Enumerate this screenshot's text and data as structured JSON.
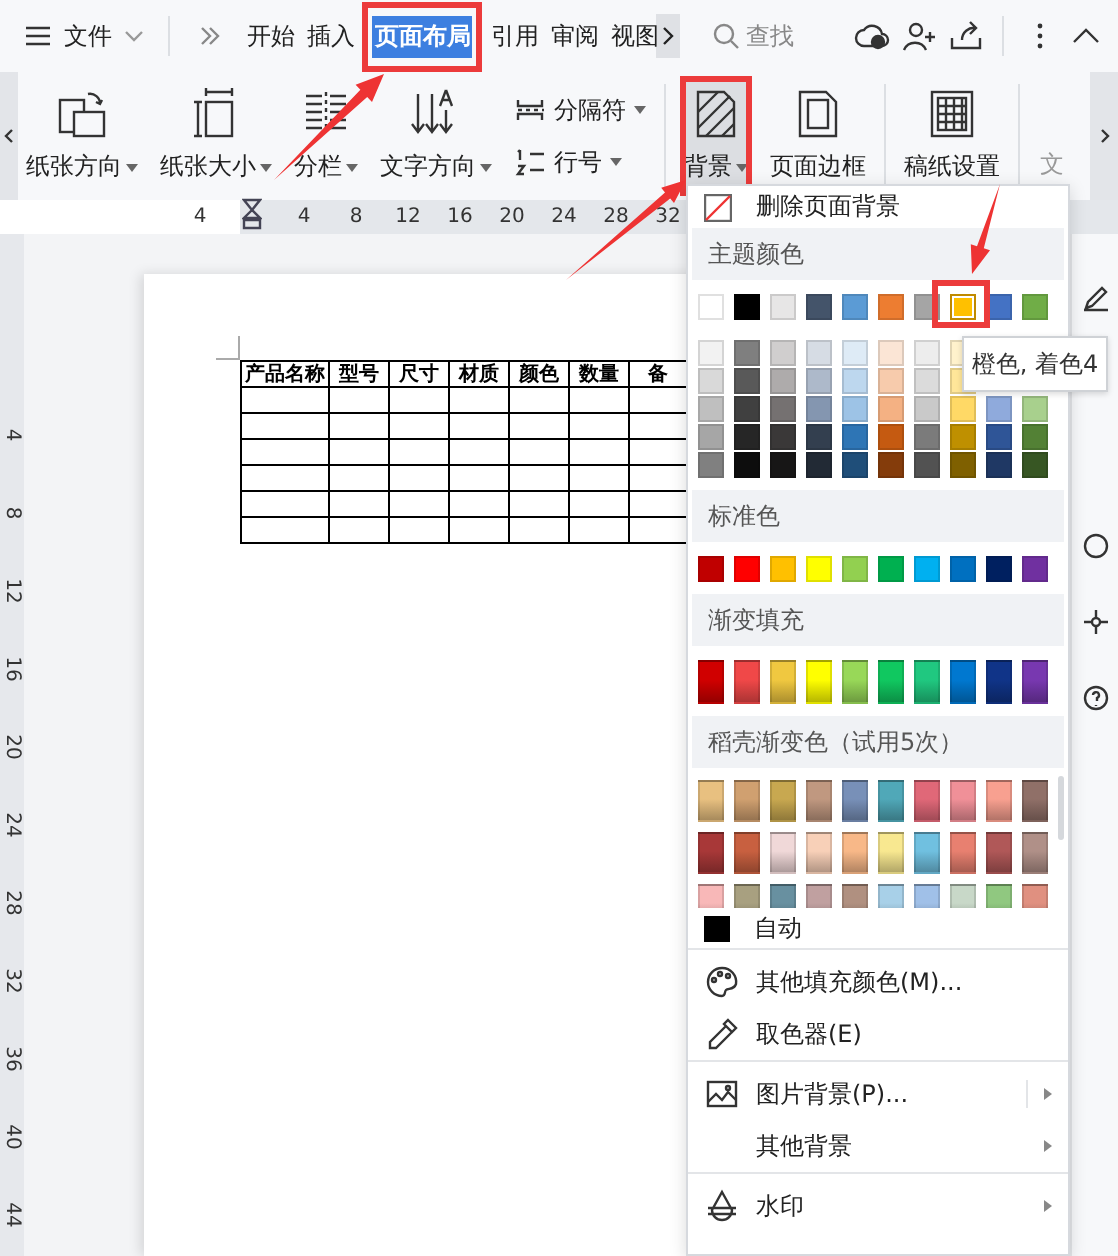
{
  "menu_button": {
    "label": "文件"
  },
  "tabs": [
    {
      "label": "开始",
      "selected": false
    },
    {
      "label": "插入",
      "selected": false
    },
    {
      "label": "页面布局",
      "selected": true
    },
    {
      "label": "引用",
      "selected": false
    },
    {
      "label": "审阅",
      "selected": false
    },
    {
      "label": "视图",
      "selected": false
    }
  ],
  "search": {
    "placeholder": "查找"
  },
  "ribbon": [
    {
      "kind": "orientation",
      "label": "纸张方向",
      "dropdown": true
    },
    {
      "kind": "size",
      "label": "纸张大小",
      "dropdown": true
    },
    {
      "kind": "columns",
      "label": "分栏",
      "dropdown": true
    },
    {
      "kind": "direction",
      "label": "文字方向",
      "dropdown": true
    },
    {
      "kind": "breaks",
      "label": "分隔符",
      "dropdown": true
    },
    {
      "kind": "line_numbers",
      "label": "行号",
      "dropdown": true
    },
    {
      "kind": "background",
      "label": "背景",
      "dropdown": true,
      "open": true,
      "separator_before": true
    },
    {
      "kind": "border",
      "label": "页面边框",
      "dropdown": false
    },
    {
      "kind": "grid",
      "label": "稿纸设置",
      "dropdown": false,
      "separator_before": true
    },
    {
      "kind": "partial",
      "label": "文",
      "dropdown": false,
      "separator_before": true
    }
  ],
  "ruler": {
    "top_marks": [
      "4",
      "4",
      "8",
      "12",
      "16",
      "20",
      "24",
      "28",
      "32"
    ],
    "left_marks": [
      "4",
      "8",
      "12",
      "16",
      "20",
      "24",
      "28",
      "32",
      "36",
      "40",
      "44"
    ]
  },
  "document": {
    "table": {
      "columns": [
        "产品名称",
        "型号",
        "尺寸",
        "材质",
        "颜色",
        "数量",
        "备"
      ]
    }
  },
  "background_menu": {
    "remove": {
      "label": "删除页面背景"
    },
    "sections": [
      {
        "kind": "theme",
        "title": "主题颜色",
        "colors": [
          {
            "color": "#ffffff",
            "selected": false,
            "shades": [
              {
                "color": "#f2f2f2"
              },
              {
                "color": "#d9d9d9"
              },
              {
                "color": "#bfbfbf"
              },
              {
                "color": "#a6a6a6"
              },
              {
                "color": "#808080"
              }
            ]
          },
          {
            "color": "#000000",
            "selected": false,
            "shades": [
              {
                "color": "#7f7f7f"
              },
              {
                "color": "#595959"
              },
              {
                "color": "#404040"
              },
              {
                "color": "#262626"
              },
              {
                "color": "#0d0d0d"
              }
            ]
          },
          {
            "color": "#e7e6e6",
            "selected": false,
            "shades": [
              {
                "color": "#d0cece"
              },
              {
                "color": "#aeabab"
              },
              {
                "color": "#757171"
              },
              {
                "color": "#3a3838"
              },
              {
                "color": "#171616"
              }
            ]
          },
          {
            "color": "#44546a",
            "selected": false,
            "shades": [
              {
                "color": "#d6dce4"
              },
              {
                "color": "#adb9ca"
              },
              {
                "color": "#8496b0"
              },
              {
                "color": "#333f4f"
              },
              {
                "color": "#222a35"
              }
            ]
          },
          {
            "color": "#5b9bd5",
            "selected": false,
            "shades": [
              {
                "color": "#deebf6"
              },
              {
                "color": "#bdd7ee"
              },
              {
                "color": "#9dc3e6"
              },
              {
                "color": "#2e75b5"
              },
              {
                "color": "#1f4e79"
              }
            ]
          },
          {
            "color": "#ed7d31",
            "selected": false,
            "shades": [
              {
                "color": "#fbe5d5"
              },
              {
                "color": "#f7cbac"
              },
              {
                "color": "#f4b183"
              },
              {
                "color": "#c55a11"
              },
              {
                "color": "#843c0b"
              }
            ]
          },
          {
            "color": "#a5a5a5",
            "selected": false,
            "shades": [
              {
                "color": "#ededed"
              },
              {
                "color": "#dbdbdb"
              },
              {
                "color": "#c9c9c9"
              },
              {
                "color": "#7b7b7b"
              },
              {
                "color": "#525252"
              }
            ]
          },
          {
            "color": "#ffc000",
            "selected": true,
            "shades": [
              {
                "color": "#fff2cc"
              },
              {
                "color": "#ffe699"
              },
              {
                "color": "#ffd966"
              },
              {
                "color": "#bf9000"
              },
              {
                "color": "#7f6000"
              }
            ]
          },
          {
            "color": "#4472c4",
            "selected": false,
            "shades": [
              {
                "color": "#8faadc"
              },
              {
                "color": "#2f5597"
              },
              {
                "color": "#1f3864"
              }
            ]
          },
          {
            "color": "#70ad47",
            "selected": false,
            "shades": [
              {
                "color": "#a8d08d"
              },
              {
                "color": "#538135"
              },
              {
                "color": "#375623"
              }
            ]
          }
        ]
      },
      {
        "kind": "standard",
        "title": "标准色",
        "colors": [
          {
            "color": "#c00000"
          },
          {
            "color": "#ff0000"
          },
          {
            "color": "#ffc000"
          },
          {
            "color": "#ffff00"
          },
          {
            "color": "#92d050"
          },
          {
            "color": "#00b050"
          },
          {
            "color": "#00b0f0"
          },
          {
            "color": "#0070c0"
          },
          {
            "color": "#002060"
          },
          {
            "color": "#7030a0"
          }
        ]
      },
      {
        "kind": "gradient",
        "title": "渐变填充",
        "colors": [
          {
            "color": "#d00000"
          },
          {
            "color": "#f04848"
          },
          {
            "color": "#f0c840"
          },
          {
            "color": "#ffff00"
          },
          {
            "color": "#98d858"
          },
          {
            "color": "#10c860"
          },
          {
            "color": "#20c880"
          },
          {
            "color": "#0078d0"
          },
          {
            "color": "#103488"
          },
          {
            "color": "#7838b0"
          }
        ]
      },
      {
        "kind": "docer",
        "title": "稻壳渐变色（试用5次）",
        "rows": [
          {
            "colors": [
              {
                "color": "#e8c080"
              },
              {
                "color": "#d0a070"
              },
              {
                "color": "#c8a850"
              },
              {
                "color": "#c09880"
              },
              {
                "color": "#7890b8"
              },
              {
                "color": "#50a8b8"
              },
              {
                "color": "#e06878"
              },
              {
                "color": "#f09098"
              },
              {
                "color": "#f8a090"
              },
              {
                "color": "#907068"
              }
            ]
          },
          {
            "colors": [
              {
                "color": "#a83838"
              },
              {
                "color": "#c86040"
              },
              {
                "color": "#f0d8d8"
              },
              {
                "color": "#f8d0b8"
              },
              {
                "color": "#f8b888"
              },
              {
                "color": "#f8e890"
              },
              {
                "color": "#70c0e0"
              },
              {
                "color": "#e88070"
              },
              {
                "color": "#b05858"
              },
              {
                "color": "#b09088"
              }
            ]
          },
          {
            "colors": [
              {
                "color": "#f8b8b8"
              },
              {
                "color": "#a8a080"
              },
              {
                "color": "#6890a0"
              },
              {
                "color": "#c0a0a0"
              },
              {
                "color": "#b09080"
              },
              {
                "color": "#a8d0e8"
              },
              {
                "color": "#a0c0e8"
              },
              {
                "color": "#c8d8c8"
              },
              {
                "color": "#90c880"
              },
              {
                "color": "#e09080"
              }
            ]
          }
        ]
      }
    ],
    "auto": {
      "label": "自动",
      "color": "#000000"
    },
    "items": [
      {
        "kind": "palette",
        "label": "其他填充颜色(M)...",
        "submenu": false,
        "separator_before": true
      },
      {
        "kind": "eyedropper",
        "label": "取色器(E)",
        "submenu": false
      },
      {
        "kind": "picture",
        "label": "图片背景(P)...",
        "submenu": true,
        "separator_before": true
      },
      {
        "kind": "none",
        "label": "其他背景",
        "submenu": true
      },
      {
        "kind": "watermark",
        "label": "水印",
        "submenu": true,
        "separator_before": true
      }
    ]
  },
  "tooltip": {
    "text": "橙色, 着色4"
  }
}
